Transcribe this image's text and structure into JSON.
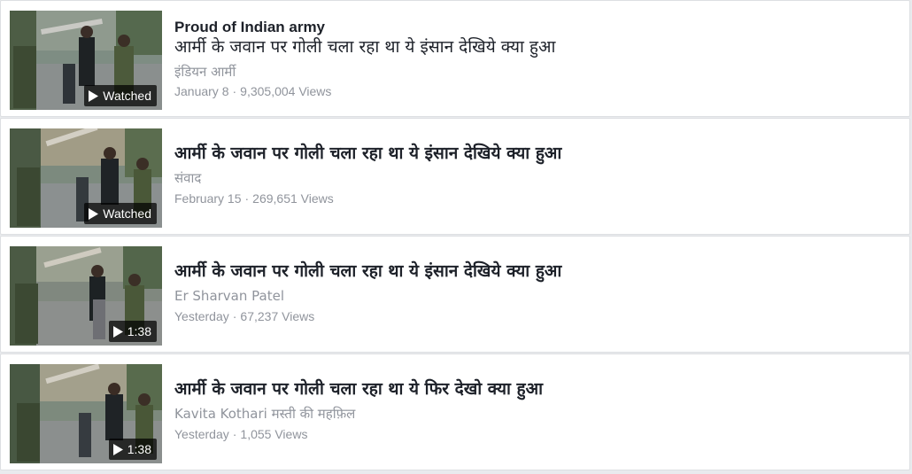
{
  "videos": [
    {
      "title_en": "Proud of Indian army",
      "title": "आर्मी के जवान पर गोली चला रहा था ये इंसान देखिये क्या हुआ",
      "channel": "इंडियन आर्मी",
      "date": "January 8",
      "separator": "·",
      "views": "9,305,004 Views",
      "badge": "Watched",
      "badge_icon": "play-icon"
    },
    {
      "title": "आर्मी के जवान पर गोली चला रहा था ये इंसान देखिये क्या हुआ",
      "channel": "संवाद",
      "date": "February 15",
      "separator": "·",
      "views": "269,651 Views",
      "badge": "Watched",
      "badge_icon": "play-icon"
    },
    {
      "title": "आर्मी के जवान पर गोली चला रहा था ये इंसान देखिये क्या हुआ",
      "channel": "Er Sharvan Patel",
      "date": "Yesterday",
      "separator": "·",
      "views": "67,237 Views",
      "badge": "1:38",
      "badge_icon": "play-icon"
    },
    {
      "title": "आर्मी के जवान पर गोली चला रहा था ये फिर देखो क्या हुआ",
      "channel": "Kavita Kothari मस्ती की महफ़िल",
      "date": "Yesterday",
      "separator": "·",
      "views": "1,055 Views",
      "badge": "1:38",
      "badge_icon": "play-icon"
    }
  ],
  "colors": {
    "background": "#e9ebee",
    "card": "#ffffff",
    "title": "#1d2129",
    "secondary": "#90949c"
  }
}
